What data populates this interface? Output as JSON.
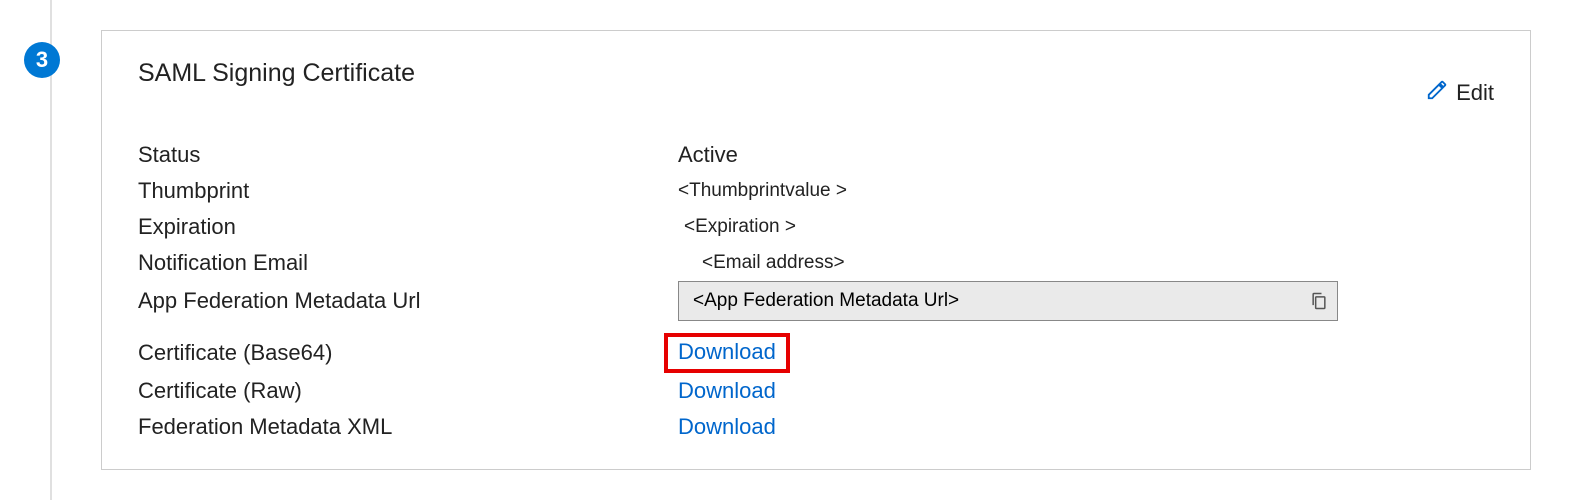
{
  "step_number": "3",
  "card": {
    "title": "SAML Signing Certificate",
    "edit_label": "Edit"
  },
  "fields": {
    "status": {
      "label": "Status",
      "value": "Active"
    },
    "thumbprint": {
      "label": "Thumbprint",
      "value": "<Thumbprintvalue >"
    },
    "expiration": {
      "label": "Expiration",
      "value": "<Expiration >"
    },
    "notification_email": {
      "label": "Notification Email",
      "value": "<Email address>"
    },
    "metadata_url": {
      "label": "App Federation Metadata Url",
      "value": "<App Federation Metadata Url>"
    },
    "cert_base64": {
      "label": "Certificate (Base64)",
      "action": "Download"
    },
    "cert_raw": {
      "label": "Certificate (Raw)",
      "action": "Download"
    },
    "fed_xml": {
      "label": "Federation Metadata XML",
      "action": "Download"
    }
  }
}
